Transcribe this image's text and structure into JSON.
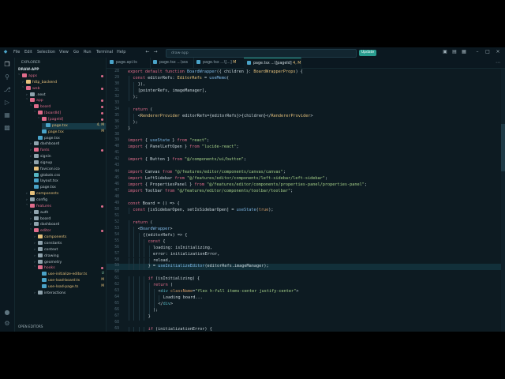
{
  "titlebar": {
    "menu": [
      "File",
      "Edit",
      "Selection",
      "View",
      "Go",
      "Run",
      "Terminal",
      "Help"
    ],
    "search_text": "draw-app",
    "update_label": "Update"
  },
  "sidebar": {
    "title": "EXPLORER",
    "root": "DRAW-APP",
    "items": [
      {
        "label": "apps",
        "depth": 0,
        "kind": "folder",
        "open": true,
        "color": "#e06c8b"
      },
      {
        "label": "http_backend",
        "depth": 1,
        "kind": "folder",
        "open": false,
        "color": "#e5c07b"
      },
      {
        "label": "web",
        "depth": 1,
        "kind": "folder",
        "open": true,
        "color": "#e06c8b"
      },
      {
        "label": ".next",
        "depth": 2,
        "kind": "folder",
        "open": false,
        "color": "#8fa3ad"
      },
      {
        "label": "app",
        "depth": 2,
        "kind": "folder",
        "open": true,
        "color": "#e06c8b"
      },
      {
        "label": "board",
        "depth": 3,
        "kind": "folder",
        "open": true,
        "color": "#e06c8b"
      },
      {
        "label": "[boardId]",
        "depth": 4,
        "kind": "folder",
        "open": true,
        "color": "#e06c8b"
      },
      {
        "label": "[pageId]",
        "depth": 5,
        "kind": "folder",
        "open": true,
        "color": "#e06c8b"
      },
      {
        "label": "page.tsx",
        "depth": 6,
        "kind": "file",
        "color": "#4aa3c8",
        "badge": "4, M",
        "selected": true
      },
      {
        "label": "page.tsx",
        "depth": 5,
        "kind": "file",
        "color": "#4aa3c8",
        "badge": "M"
      },
      {
        "label": "page.tsx",
        "depth": 4,
        "kind": "file",
        "color": "#4aa3c8"
      },
      {
        "label": "dashboard",
        "depth": 3,
        "kind": "folder",
        "open": false,
        "color": "#8fa3ad"
      },
      {
        "label": "fonts",
        "depth": 3,
        "kind": "folder",
        "open": false,
        "color": "#e06c8b"
      },
      {
        "label": "signin",
        "depth": 3,
        "kind": "folder",
        "open": false,
        "color": "#8fa3ad"
      },
      {
        "label": "signup",
        "depth": 3,
        "kind": "folder",
        "open": false,
        "color": "#8fa3ad"
      },
      {
        "label": "favicon.ico",
        "depth": 3,
        "kind": "file",
        "color": "#e5c07b"
      },
      {
        "label": "globals.css",
        "depth": 3,
        "kind": "file",
        "color": "#56b6c2"
      },
      {
        "label": "layout.tsx",
        "depth": 3,
        "kind": "file",
        "color": "#4aa3c8"
      },
      {
        "label": "page.tsx",
        "depth": 3,
        "kind": "file",
        "color": "#4aa3c8"
      },
      {
        "label": "components",
        "depth": 2,
        "kind": "folder",
        "open": false,
        "color": "#e5c07b"
      },
      {
        "label": "config",
        "depth": 2,
        "kind": "folder",
        "open": false,
        "color": "#8fa3ad"
      },
      {
        "label": "features",
        "depth": 2,
        "kind": "folder",
        "open": true,
        "color": "#e06c8b"
      },
      {
        "label": "auth",
        "depth": 3,
        "kind": "folder",
        "open": false,
        "color": "#8fa3ad"
      },
      {
        "label": "board",
        "depth": 3,
        "kind": "folder",
        "open": false,
        "color": "#8fa3ad"
      },
      {
        "label": "dashboard",
        "depth": 3,
        "kind": "folder",
        "open": false,
        "color": "#8fa3ad"
      },
      {
        "label": "editor",
        "depth": 3,
        "kind": "folder",
        "open": true,
        "color": "#e06c8b"
      },
      {
        "label": "components",
        "depth": 4,
        "kind": "folder",
        "open": false,
        "color": "#e5c07b"
      },
      {
        "label": "constants",
        "depth": 4,
        "kind": "folder",
        "open": false,
        "color": "#8fa3ad"
      },
      {
        "label": "context",
        "depth": 4,
        "kind": "folder",
        "open": false,
        "color": "#8fa3ad"
      },
      {
        "label": "drawing",
        "depth": 4,
        "kind": "folder",
        "open": false,
        "color": "#8fa3ad"
      },
      {
        "label": "geometry",
        "depth": 4,
        "kind": "folder",
        "open": false,
        "color": "#8fa3ad"
      },
      {
        "label": "hooks",
        "depth": 4,
        "kind": "folder",
        "open": true,
        "color": "#e06c8b"
      },
      {
        "label": "use-initialize-editor.ts",
        "depth": 5,
        "kind": "file",
        "color": "#4aa3c8",
        "badge": "U"
      },
      {
        "label": "use-load-board.ts",
        "depth": 5,
        "kind": "file",
        "color": "#4aa3c8",
        "badge": "M"
      },
      {
        "label": "use-load-page.ts",
        "depth": 5,
        "kind": "file",
        "color": "#4aa3c8",
        "badge": "M"
      },
      {
        "label": "interactions",
        "depth": 4,
        "kind": "folder",
        "open": false,
        "color": "#8fa3ad"
      }
    ],
    "open_editors": "OPEN EDITORS"
  },
  "tabs": [
    {
      "label": "page.api.ts",
      "badge": "",
      "active": false
    },
    {
      "label": "page.tsx ...\\sss",
      "badge": "",
      "active": false
    },
    {
      "label": "page.tsx ...\\[...]",
      "badge": "M",
      "active": false
    },
    {
      "label": "page.tsx ...\\[pageId]",
      "badge": "4, M",
      "active": true
    }
  ],
  "editor": {
    "lines": [
      {
        "n": "28",
        "indent": 0,
        "t": "export default function BoardWrapper({ children }: BoardWrapperProps) {"
      },
      {
        "n": "29",
        "indent": 1,
        "t": "const editorRefs: EditorRefs = useMemo("
      },
      {
        "n": "30",
        "indent": 2,
        "t": "}),"
      },
      {
        "n": "31",
        "indent": 2,
        "t": "[pointerRefs, imageManager],"
      },
      {
        "n": "32",
        "indent": 1,
        "t": ");"
      },
      {
        "n": "33",
        "indent": 0,
        "t": ""
      },
      {
        "n": "34",
        "indent": 1,
        "t": "return ("
      },
      {
        "n": "35",
        "indent": 2,
        "t": "<RendererProvider editorRefs={editorRefs}>{children}</RendererProvider>"
      },
      {
        "n": "36",
        "indent": 1,
        "t": ");"
      },
      {
        "n": "37",
        "indent": 0,
        "t": "}"
      },
      {
        "n": "38",
        "indent": 0,
        "t": ""
      },
      {
        "n": "39",
        "indent": 0,
        "t": "import { useState } from \"react\";"
      },
      {
        "n": "40",
        "indent": 0,
        "t": "import { PanelLeftOpen } from \"lucide-react\";"
      },
      {
        "n": "41",
        "indent": 0,
        "t": ""
      },
      {
        "n": "42",
        "indent": 0,
        "t": "import { Button } from \"@/components/ui/button\";"
      },
      {
        "n": "43",
        "indent": 0,
        "t": ""
      },
      {
        "n": "44",
        "indent": 0,
        "t": "import Canvas from \"@/features/editor/components/canvas/canvas\";"
      },
      {
        "n": "45",
        "indent": 0,
        "t": "import LeftSidebar from \"@/features/editor/components/left-sidebar/left-sidebar\";"
      },
      {
        "n": "46",
        "indent": 0,
        "t": "import { PropertiesPanel } from \"@/features/editor/components/properties-panel/properties-panel\";"
      },
      {
        "n": "47",
        "indent": 0,
        "t": "import Toolbar from \"@/features/editor/components/toolbar/toolbar\";"
      },
      {
        "n": "48",
        "indent": 0,
        "t": ""
      },
      {
        "n": "49",
        "indent": 0,
        "t": "const Board = () => {"
      },
      {
        "n": "50",
        "indent": 1,
        "t": "const [isSidebarOpen, setIsSidebarOpen] = useState(true);"
      },
      {
        "n": "51",
        "indent": 0,
        "t": ""
      },
      {
        "n": "52",
        "indent": 1,
        "t": "return ("
      },
      {
        "n": "53",
        "indent": 2,
        "t": "<BoardWrapper>"
      },
      {
        "n": "54",
        "indent": 3,
        "t": "{(editorRefs) => {"
      },
      {
        "n": "55",
        "indent": 4,
        "t": "const {"
      },
      {
        "n": "56",
        "indent": 5,
        "t": "loading: isInitializing,"
      },
      {
        "n": "57",
        "indent": 5,
        "t": "error: initializationError,"
      },
      {
        "n": "58",
        "indent": 5,
        "t": "reload,"
      },
      {
        "n": "59",
        "indent": 4,
        "t": "} = useInitializeEditor(editorRefs.imageManager);"
      },
      {
        "n": "60",
        "indent": 0,
        "t": ""
      },
      {
        "n": "61",
        "indent": 4,
        "t": "if (isInitializing) {"
      },
      {
        "n": "62",
        "indent": 5,
        "t": "return ("
      },
      {
        "n": "63",
        "indent": 6,
        "t": "<div className=\"flex h-full items-center justify-center\">"
      },
      {
        "n": "64",
        "indent": 7,
        "t": "Loading board..."
      },
      {
        "n": "65",
        "indent": 6,
        "t": "</div>"
      },
      {
        "n": "66",
        "indent": 5,
        "t": ");"
      },
      {
        "n": "67",
        "indent": 4,
        "t": "}"
      },
      {
        "n": "68",
        "indent": 0,
        "t": ""
      },
      {
        "n": "69",
        "indent": 4,
        "t": "if (initializationError) {"
      },
      {
        "n": "70",
        "indent": 5,
        "t": "return ("
      },
      {
        "n": "71",
        "indent": 6,
        "t": "<div className=\"flex h-full flex-col items-center justify-center gap-4\">"
      }
    ]
  },
  "colors": {
    "accent": "#2a9d8f",
    "background": "#0d1b22",
    "keyword": "#e06c8b",
    "string": "#a6d189",
    "type": "#e5c07b",
    "function": "#7fb8e6"
  }
}
